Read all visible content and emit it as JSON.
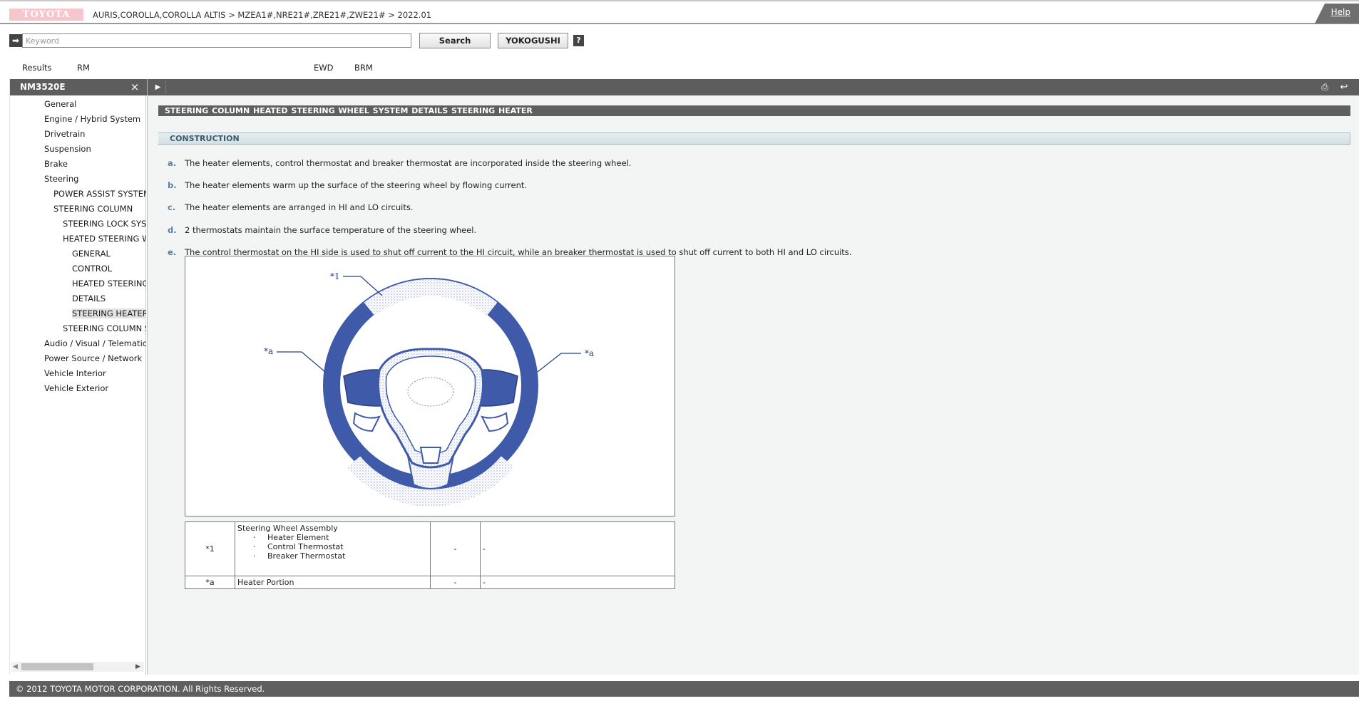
{
  "header": {
    "logo_text": "TOYOTA",
    "breadcrumb": "AURIS,COROLLA,COROLLA ALTIS > MZEA1#,NRE21#,ZRE21#,ZWE21# > 2022.01",
    "help_label": "Help"
  },
  "search": {
    "placeholder": "Keyword",
    "value": "",
    "search_label": "Search",
    "yokogushi_label": "YOKOGUSHI",
    "help_q": "?"
  },
  "tabs": [
    "Results",
    "RM",
    "EWD",
    "BRM"
  ],
  "left_panel": {
    "title": "NM3520E",
    "close_icon": "×",
    "tree": [
      {
        "label": "General",
        "level": 0
      },
      {
        "label": "Engine / Hybrid System",
        "level": 0
      },
      {
        "label": "Drivetrain",
        "level": 0
      },
      {
        "label": "Suspension",
        "level": 0
      },
      {
        "label": "Brake",
        "level": 0
      },
      {
        "label": "Steering",
        "level": 0
      },
      {
        "label": "POWER ASSIST SYSTEM",
        "level": 1
      },
      {
        "label": "STEERING COLUMN",
        "level": 1
      },
      {
        "label": "STEERING LOCK SYSTEM",
        "level": 2
      },
      {
        "label": "HEATED STEERING WHEEL SYSTEM",
        "level": 2
      },
      {
        "label": "GENERAL",
        "level": 3
      },
      {
        "label": "CONTROL",
        "level": 3
      },
      {
        "label": "HEATED STEERING WHEEL SYSTEM",
        "level": 3
      },
      {
        "label": "DETAILS",
        "level": 3
      },
      {
        "label": "STEERING HEATER",
        "level": 3,
        "selected": true
      },
      {
        "label": "STEERING COLUMN SYSTEM",
        "level": 2
      },
      {
        "label": "Audio / Visual / Telematics",
        "level": 0
      },
      {
        "label": "Power Source / Network",
        "level": 0
      },
      {
        "label": "Vehicle Interior",
        "level": 0
      },
      {
        "label": "Vehicle Exterior",
        "level": 0
      }
    ]
  },
  "main": {
    "title": "STEERING COLUMN  HEATED STEERING WHEEL SYSTEM  DETAILS  STEERING HEATER",
    "section": "CONSTRUCTION",
    "items": [
      {
        "letter": "a.",
        "text": "The heater elements, control thermostat and breaker thermostat are incorporated inside the steering wheel."
      },
      {
        "letter": "b.",
        "text": "The heater elements warm up the surface of the steering wheel by flowing current."
      },
      {
        "letter": "c.",
        "text": "The heater elements are arranged in HI and LO circuits."
      },
      {
        "letter": "d.",
        "text": "2 thermostats maintain the surface temperature of the steering wheel."
      },
      {
        "letter": "e.",
        "text": "The control thermostat on the HI side is used to shut off current to the HI circuit, while an breaker thermostat is used to shut off current to both HI and LO circuits."
      }
    ],
    "figure": {
      "callout_1": "*1",
      "callout_a_left": "*a",
      "callout_a_right": "*a",
      "wheel_color": "#3f5aa8"
    },
    "legend": [
      {
        "code": "*1",
        "name": "Steering Wheel Assembly",
        "subitems": [
          "Heater Element",
          "Control Thermostat",
          "Breaker Thermostat"
        ],
        "c3": "-",
        "c4": "-"
      },
      {
        "code": "*a",
        "name": "Heater Portion",
        "subitems": [],
        "c3": "-",
        "c4": "-"
      }
    ]
  },
  "footer": {
    "copyright": "© 2012 TOYOTA MOTOR CORPORATION. All Rights Reserved."
  }
}
